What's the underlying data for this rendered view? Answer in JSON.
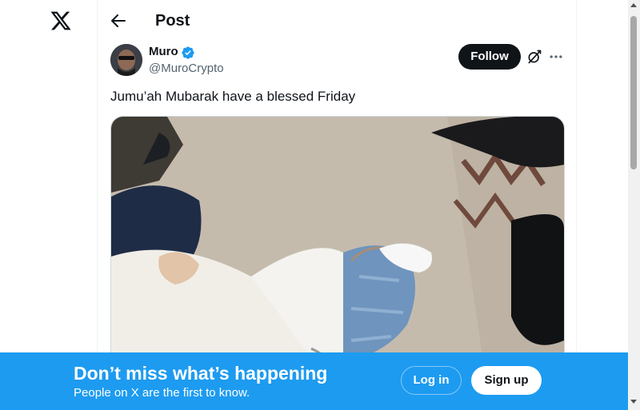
{
  "header": {
    "title": "Post"
  },
  "tweet": {
    "author": {
      "display_name": "Muro",
      "handle": "@MuroCrypto",
      "verified": true
    },
    "follow_label": "Follow",
    "text": "Jumu’ah Mubarak have a blessed Friday"
  },
  "banner": {
    "title": "Don’t miss what’s happening",
    "subtitle": "People on X are the first to know.",
    "login_label": "Log in",
    "signup_label": "Sign up"
  },
  "icons": [
    "x-logo-icon",
    "back-arrow-icon",
    "verified-badge-icon",
    "grok-icon",
    "more-icon"
  ],
  "colors": {
    "accent": "#1d9bf0",
    "text": "#0f1419",
    "muted": "#536471"
  }
}
